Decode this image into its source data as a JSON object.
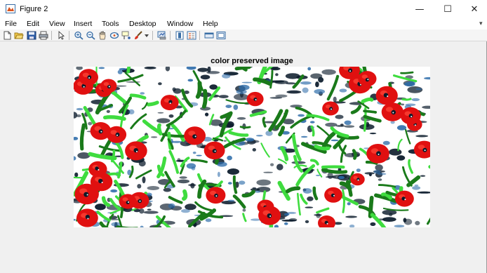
{
  "window": {
    "title": "Figure 2",
    "min_symbol": "—",
    "max_symbol": "☐",
    "close_symbol": "✕"
  },
  "menu": [
    {
      "label": "File",
      "name": "menu-file"
    },
    {
      "label": "Edit",
      "name": "menu-edit"
    },
    {
      "label": "View",
      "name": "menu-view"
    },
    {
      "label": "Insert",
      "name": "menu-insert"
    },
    {
      "label": "Tools",
      "name": "menu-tools"
    },
    {
      "label": "Desktop",
      "name": "menu-desktop"
    },
    {
      "label": "Window",
      "name": "menu-window"
    },
    {
      "label": "Help",
      "name": "menu-help"
    }
  ],
  "toolbar_icons": [
    "new-figure-icon",
    "open-file-icon",
    "save-icon",
    "print-icon",
    "edit-plot-icon",
    "zoom-in-icon",
    "zoom-out-icon",
    "pan-icon",
    "rotate-3d-icon",
    "data-cursor-icon",
    "brush-icon",
    "brush-dropdown-icon",
    "link-plot-icon",
    "insert-colorbar-icon",
    "insert-legend-icon",
    "hide-plot-tools-icon",
    "show-plot-tools-icon"
  ],
  "axes": {
    "title": "color preserved image"
  },
  "image": {
    "subject": "red-tulip-field-image",
    "colors": {
      "tulip": "#e01010",
      "leaf": "#1a7a1a",
      "leaf_bright": "#3fdc3f",
      "shadow": "#0a1a2a",
      "blue": "#2a6aa8",
      "background": "#ffffff"
    }
  }
}
